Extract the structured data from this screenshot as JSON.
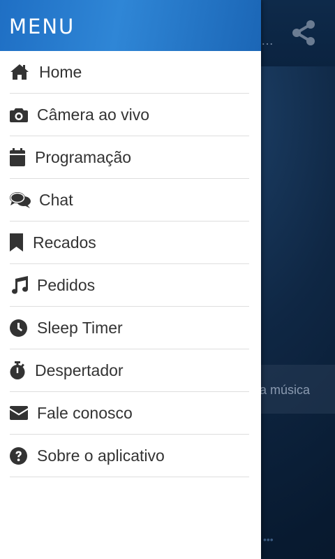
{
  "background": {
    "dots": "…",
    "song_text": "a música",
    "bottom_dots": "•••"
  },
  "drawer": {
    "title": "MENU",
    "items": [
      {
        "label": "Home",
        "icon": "home-icon"
      },
      {
        "label": "Câmera ao vivo",
        "icon": "camera-icon"
      },
      {
        "label": "Programação",
        "icon": "calendar-icon"
      },
      {
        "label": "Chat",
        "icon": "chat-icon"
      },
      {
        "label": "Recados",
        "icon": "bookmark-icon"
      },
      {
        "label": "Pedidos",
        "icon": "music-icon"
      },
      {
        "label": "Sleep Timer",
        "icon": "clock-icon"
      },
      {
        "label": "Despertador",
        "icon": "stopwatch-icon"
      },
      {
        "label": "Fale conosco",
        "icon": "envelope-icon"
      },
      {
        "label": "Sobre o aplicativo",
        "icon": "question-icon"
      }
    ]
  },
  "colors": {
    "header_blue": "#2f86d6",
    "text": "#333333",
    "divider": "#dedede"
  }
}
